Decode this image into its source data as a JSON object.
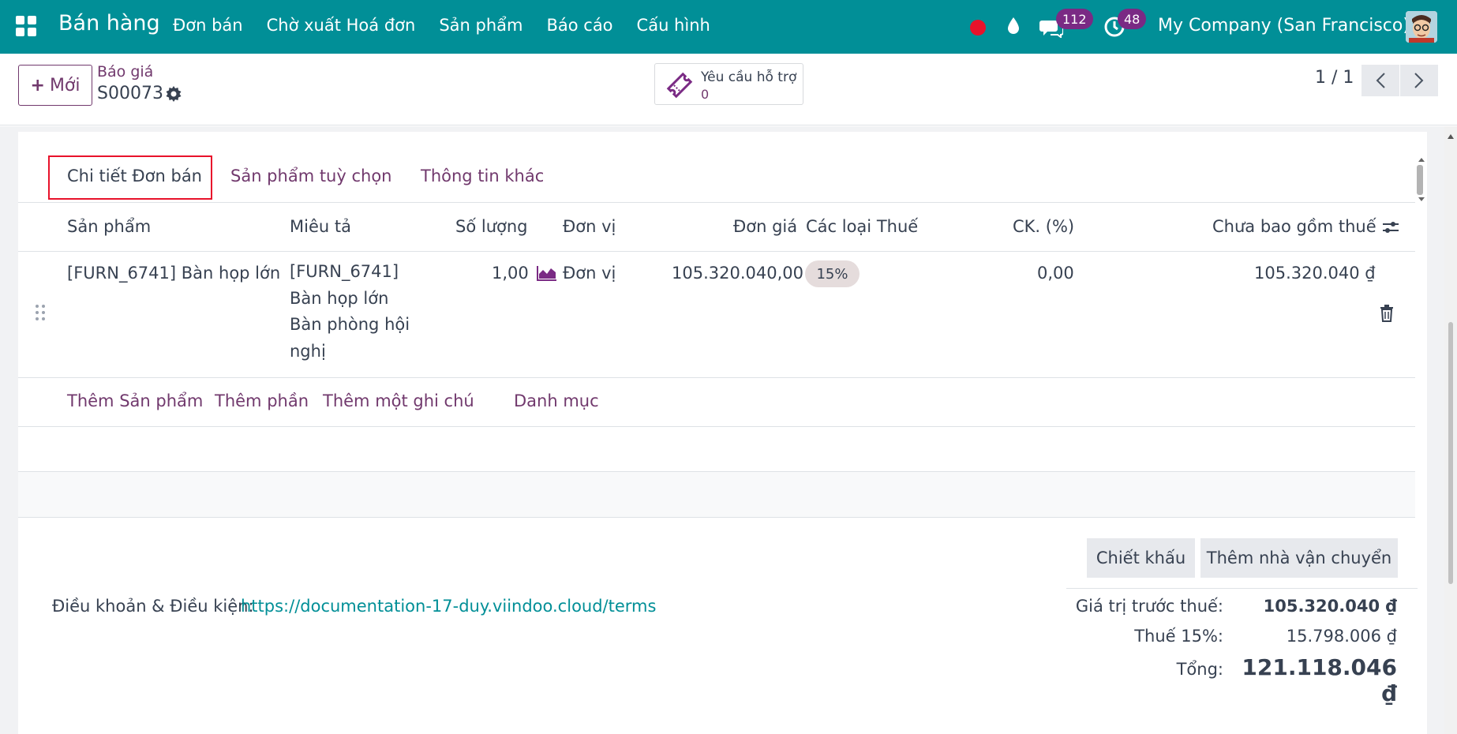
{
  "navbar": {
    "app_name": "Bán hàng",
    "menu": [
      "Đơn bán",
      "Chờ xuất Hoá đơn",
      "Sản phẩm",
      "Báo cáo",
      "Cấu hình"
    ],
    "messages_count": "112",
    "activities_count": "48",
    "company": "My Company (San Francisco)"
  },
  "control_panel": {
    "new_label": "Mới",
    "breadcrumb_parent": "Báo giá",
    "record_name": "S00073",
    "support_label": "Yêu cầu hỗ trợ",
    "support_count": "0",
    "pager": "1 / 1"
  },
  "tabs": [
    "Chi tiết Đơn bán",
    "Sản phẩm tuỳ chọn",
    "Thông tin khác"
  ],
  "table": {
    "columns": [
      "Sản phẩm",
      "Miêu tả",
      "Số lượng",
      "Đơn vị",
      "Đơn giá",
      "Các loại Thuế",
      "CK. (%)",
      "Chưa bao gồm thuế"
    ],
    "row": {
      "product": "[FURN_6741] Bàn họp lớn",
      "description": [
        "[FURN_6741]",
        "Bàn họp lớn",
        "Bàn phòng hội",
        "nghị"
      ],
      "quantity": "1,00",
      "uom": "Đơn vị",
      "unit_price": "105.320.040,00",
      "tax": "15%",
      "discount": "0,00",
      "subtotal": "105.320.040 ₫"
    },
    "add_links": [
      "Thêm Sản phẩm",
      "Thêm phần",
      "Thêm một ghi chú",
      "Danh mục"
    ]
  },
  "buttons": {
    "discount": "Chiết khấu",
    "add_shipping": "Thêm nhà vận chuyển"
  },
  "terms": {
    "label": "Điều khoản & Điều kiện:",
    "link": "https://documentation-17-duy.viindoo.cloud/terms"
  },
  "totals": {
    "untaxed_label": "Giá trị trước thuế:",
    "untaxed_value": "105.320.040 ₫",
    "tax_label": "Thuế 15%:",
    "tax_value": "15.798.006 ₫",
    "total_label": "Tổng:",
    "total_value": "121.118.046 ₫"
  },
  "colors": {
    "navbar": "#018f97",
    "primary": "#71396d",
    "highlight_box": "#e8122b"
  }
}
